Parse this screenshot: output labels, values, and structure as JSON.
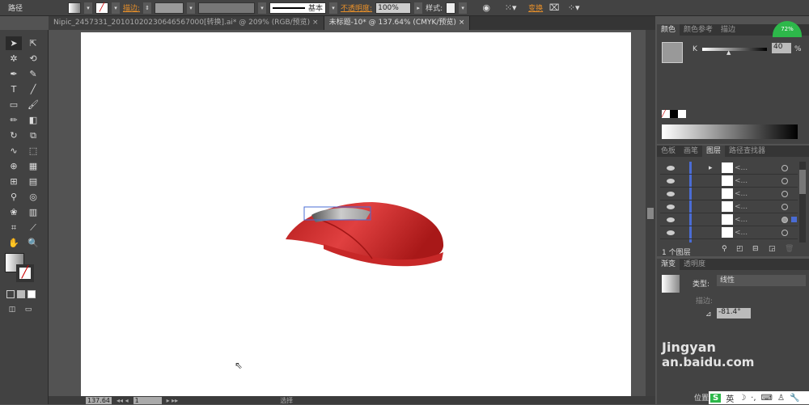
{
  "control_bar": {
    "object_type": "路径",
    "stroke_label": "描边:",
    "stroke_style": "基本",
    "opacity_label": "不透明度:",
    "opacity_value": "100%",
    "style_label": "样式:",
    "transform_label": "变换"
  },
  "doc_tabs": [
    {
      "label": "Nipic_2457331_20101020230646567000[转换].ai* @ 209% (RGB/预览)",
      "active": false
    },
    {
      "label": "未标题-10* @ 137.64% (CMYK/预览)",
      "active": true
    }
  ],
  "color_panel": {
    "tabs": [
      "颜色",
      "颜色参考",
      "描边"
    ],
    "channel": "K",
    "k_value": "40",
    "k_percent": "%"
  },
  "layers_panel": {
    "tabs": [
      "色板",
      "画笔",
      "图层",
      "路径查找器"
    ],
    "rows": [
      "<...",
      "<...",
      "<...",
      "<...",
      "<...",
      "<..."
    ],
    "footer": "1 个图层"
  },
  "gradient_panel": {
    "tabs": [
      "渐变",
      "透明度"
    ],
    "type_label": "类型:",
    "type_value": "线性",
    "stroke_label": "描边:",
    "angle_value": "-81.4°",
    "location_label": "位置"
  },
  "status_bar": {
    "zoom": "137.64",
    "page": "1",
    "tool": "选择"
  },
  "watermark": {
    "text1": "Jingyan",
    "text2": "an.baidu.com"
  },
  "ime": {
    "lang": "英"
  },
  "badge": {
    "cpu": "72%"
  },
  "colors": {
    "mouse_red": "#d42a2a",
    "accent_orange": "#e8902a",
    "selection_blue": "#4a6cd4"
  }
}
